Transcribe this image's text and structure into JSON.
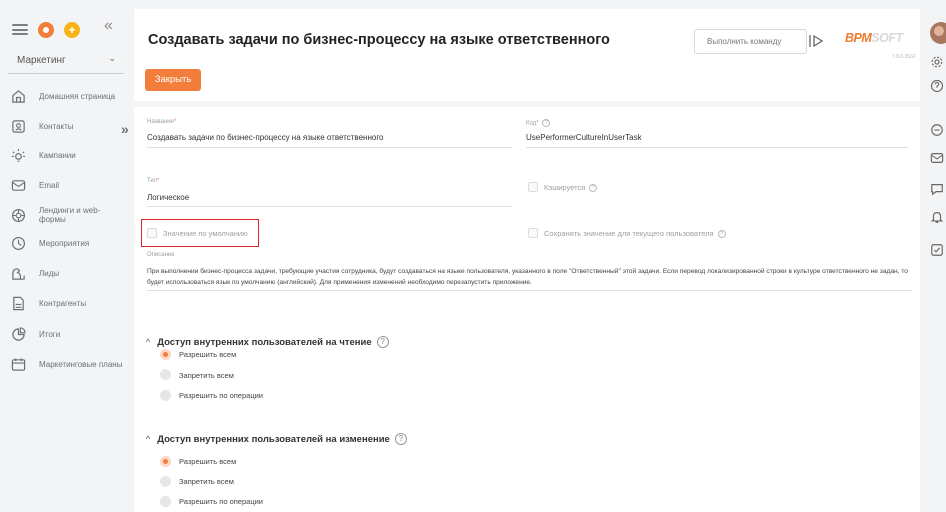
{
  "sidebar": {
    "workspace": "Маркетинг",
    "items": [
      {
        "label": "Домашняя страница",
        "icon": "home-icon"
      },
      {
        "label": "Контакты",
        "icon": "contacts-icon"
      },
      {
        "label": "Кампании",
        "icon": "campaigns-icon"
      },
      {
        "label": "Email",
        "icon": "email-icon"
      },
      {
        "label": "Лендинги и web-формы",
        "icon": "landing-icon"
      },
      {
        "label": "Мероприятия",
        "icon": "events-icon"
      },
      {
        "label": "Лиды",
        "icon": "leads-icon"
      },
      {
        "label": "Контрагенты",
        "icon": "accounts-icon"
      },
      {
        "label": "Итоги",
        "icon": "dashboards-icon"
      },
      {
        "label": "Маркетинговые планы",
        "icon": "calendar-icon"
      }
    ]
  },
  "header": {
    "title": "Создавать задачи по бизнес-процессу на языке ответственного",
    "command_placeholder": "Выполнить команду",
    "logo_orange": "BPM",
    "logo_grey": "SOFT",
    "version": "7.8.0.3562",
    "close_label": "Закрыть"
  },
  "form": {
    "name_label": "Название",
    "name_value": "Создавать задачи по бизнес-процессу на языке ответственного",
    "code_label": "Код",
    "code_value": "UsePerformerCultureInUserTask",
    "type_label": "Тип",
    "type_value": "Логическое",
    "cached_label": "Кэшируется",
    "default_label": "Значение по умолчанию",
    "save_user_label": "Сохранять значение для текущего пользователя",
    "description_label": "Описание",
    "description_value": "При выполнении бизнес-процесса задачи, требующие участия сотрудника, будут создаваться на языке пользователя, указанного в поле \"Ответственный\" этой задачи. Если перевод локализированной строки в культуре ответственного не задан, то будет использоваться язык по умолчанию (английский). Для применения изменений необходимо перезапустить приложение."
  },
  "read_access": {
    "title": "Доступ внутренних пользователей на чтение",
    "options": [
      "Разрешить всем",
      "Запретить всем",
      "Разрешить по операции"
    ],
    "selected": 0
  },
  "edit_access": {
    "title": "Доступ внутренних пользователей на изменение",
    "options": [
      "Разрешить всем",
      "Запретить всем",
      "Разрешить по операции"
    ],
    "selected": 0
  },
  "colors": {
    "accent": "#f37e3b",
    "highlight": "#e0262a"
  }
}
